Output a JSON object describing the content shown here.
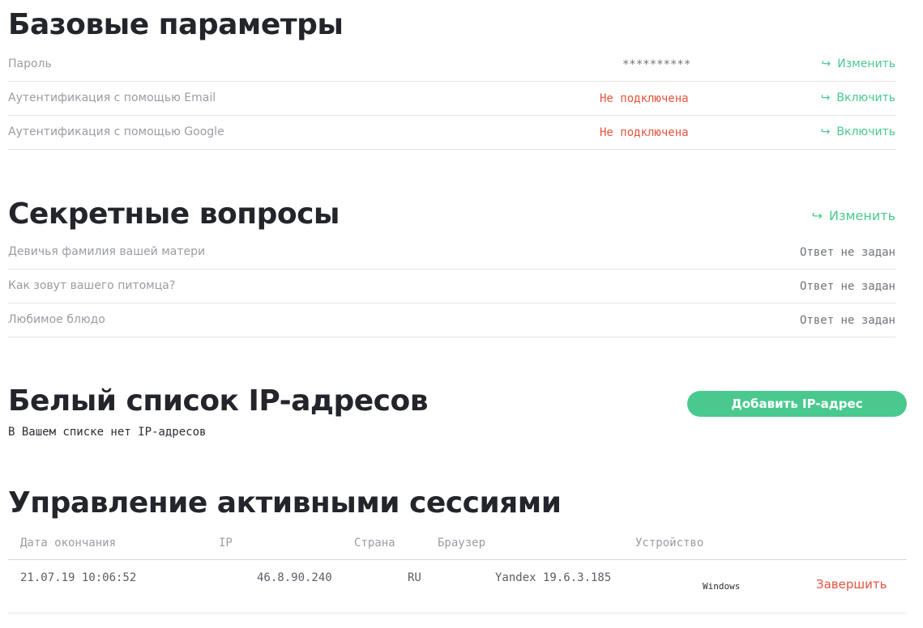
{
  "basic": {
    "title": "Базовые параметры",
    "rows": [
      {
        "label": "Пароль",
        "value": "**********",
        "action": "Изменить"
      },
      {
        "label": "Аутентификация с помощью Email",
        "value": "Не подключена",
        "action": "Включить"
      },
      {
        "label": "Аутентификация с помощью Google",
        "value": "Не подключена",
        "action": "Включить"
      }
    ]
  },
  "secret": {
    "title": "Секретные вопросы",
    "action": "Изменить",
    "rows": [
      {
        "label": "Девичья фамилия вашей матери",
        "value": "Ответ не задан"
      },
      {
        "label": "Как зовут вашего питомца?",
        "value": "Ответ не задан"
      },
      {
        "label": "Любимое блюдо",
        "value": "Ответ не задан"
      }
    ]
  },
  "whitelist": {
    "title": "Белый список IP-адресов",
    "button": "Добавить IP-адрес",
    "empty": "В Вашем списке нет IP-адресов"
  },
  "sessions": {
    "title": "Управление активными сессиями",
    "columns": [
      "Дата окончания",
      "IP",
      "Страна",
      "Браузер",
      "Устройство"
    ],
    "rows": [
      {
        "date": "21.07.19 10:06:52",
        "ip": "46.8.90.240",
        "country": "RU",
        "browser": "Yandex 19.6.3.185",
        "device": "Windows",
        "action": "Завершить"
      }
    ]
  },
  "icons": {
    "action_arrow": "redo-arrow-icon"
  },
  "colors": {
    "accent": "#4ac98f",
    "danger": "#e5533d",
    "muted": "#9a9ca3"
  }
}
